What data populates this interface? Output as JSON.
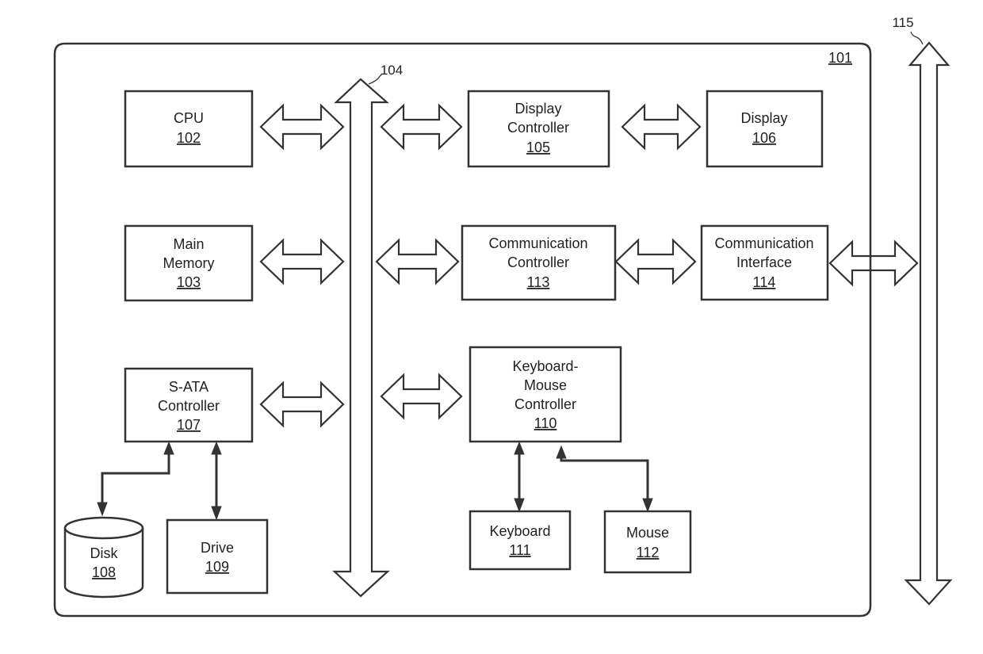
{
  "diagram": {
    "system": {
      "ref": "101"
    },
    "internal_bus": {
      "ref": "104"
    },
    "external_bus": {
      "ref": "115"
    },
    "blocks": {
      "cpu": {
        "lines": [
          "CPU"
        ],
        "ref": "102"
      },
      "main_memory": {
        "lines": [
          "Main",
          "Memory"
        ],
        "ref": "103"
      },
      "display_controller": {
        "lines": [
          "Display",
          "Controller"
        ],
        "ref": "105"
      },
      "display": {
        "lines": [
          "Display"
        ],
        "ref": "106"
      },
      "sata_controller": {
        "lines": [
          "S-ATA",
          "Controller"
        ],
        "ref": "107"
      },
      "disk": {
        "lines": [
          "Disk"
        ],
        "ref": "108"
      },
      "drive": {
        "lines": [
          "Drive"
        ],
        "ref": "109"
      },
      "keyboard_mouse_controller": {
        "lines": [
          "Keyboard-",
          "Mouse",
          "Controller"
        ],
        "ref": "110"
      },
      "keyboard": {
        "lines": [
          "Keyboard"
        ],
        "ref": "111"
      },
      "mouse": {
        "lines": [
          "Mouse"
        ],
        "ref": "112"
      },
      "communication_controller": {
        "lines": [
          "Communication",
          "Controller"
        ],
        "ref": "113"
      },
      "communication_interface": {
        "lines": [
          "Communication",
          "Interface"
        ],
        "ref": "114"
      }
    },
    "connections": [
      {
        "from": "cpu",
        "to": "internal_bus",
        "type": "bidirectional-block-arrow"
      },
      {
        "from": "main_memory",
        "to": "internal_bus",
        "type": "bidirectional-block-arrow"
      },
      {
        "from": "sata_controller",
        "to": "internal_bus",
        "type": "bidirectional-block-arrow"
      },
      {
        "from": "internal_bus",
        "to": "display_controller",
        "type": "bidirectional-block-arrow"
      },
      {
        "from": "internal_bus",
        "to": "communication_controller",
        "type": "bidirectional-block-arrow"
      },
      {
        "from": "internal_bus",
        "to": "keyboard_mouse_controller",
        "type": "bidirectional-block-arrow"
      },
      {
        "from": "display_controller",
        "to": "display",
        "type": "bidirectional-block-arrow"
      },
      {
        "from": "communication_controller",
        "to": "communication_interface",
        "type": "bidirectional-block-arrow"
      },
      {
        "from": "communication_interface",
        "to": "external_bus",
        "type": "bidirectional-block-arrow"
      },
      {
        "from": "sata_controller",
        "to": "disk",
        "type": "bidirectional-line"
      },
      {
        "from": "sata_controller",
        "to": "drive",
        "type": "bidirectional-line"
      },
      {
        "from": "keyboard_mouse_controller",
        "to": "keyboard",
        "type": "bidirectional-line"
      },
      {
        "from": "keyboard_mouse_controller",
        "to": "mouse",
        "type": "bidirectional-line"
      }
    ]
  }
}
